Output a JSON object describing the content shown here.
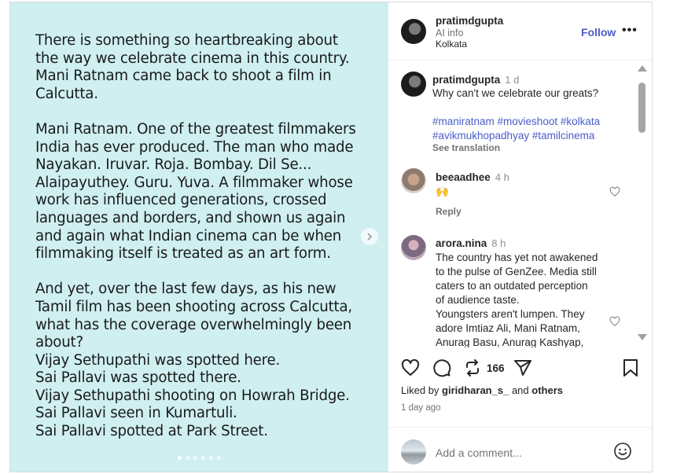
{
  "post": {
    "paragraphs": [
      [
        "There is something so heartbreaking about",
        "the way we celebrate cinema in this country.",
        "Mani Ratnam came back to shoot a film in",
        "Calcutta."
      ],
      [
        "Mani Ratnam. One of the greatest filmmakers",
        "India has ever produced. The man who made",
        "Nayakan. Iruvar. Roja. Bombay. Dil Se...",
        "Alaipayuthey. Guru. Yuva. A filmmaker whose",
        "work has influenced generations, crossed",
        "languages and borders, and shown us again",
        "and again what Indian cinema can be when",
        "filmmaking itself is treated as an art form."
      ],
      [
        "And yet, over the last few days, as his new",
        "Tamil film has been shooting across Calcutta,",
        "what has the coverage overwhelmingly been",
        "about?",
        "Vijay Sethupathi was spotted here.",
        "Sai Pallavi was spotted there.",
        "Vijay Sethupathi shooting on Howrah Bridge.",
        "Sai Pallavi seen in Kumartuli.",
        "Sai Pallavi spotted at Park Street."
      ]
    ],
    "next_icon": "chevron-right-icon"
  },
  "header": {
    "username": "pratimdgupta",
    "subtitle": "AI info",
    "location": "Kolkata",
    "follow_label": "Follow",
    "more_icon": "•••"
  },
  "caption": {
    "username": "pratimdgupta",
    "time": "1 d",
    "text": "Why can't we celebrate our greats?",
    "hashtags_line1": "#maniratnam #movieshoot #kolkata",
    "hashtags_line2": "#avikmukhopadhyay #tamilcinema",
    "see_translation": "See translation"
  },
  "comments": [
    {
      "username": "beeaadhee",
      "time": "4 h",
      "text": "🙌",
      "reply_label": "Reply"
    },
    {
      "username": "arora.nina",
      "time": "8 h",
      "lines": [
        "The country has yet not awakened",
        "to the pulse of GenZee. Media still",
        "caters to an outdated perception",
        "of audience taste.",
        "Youngsters aren't lumpen. They",
        "adore Imtiaz Ali, Mani Ratnam,",
        "Anurag Basu, Anurag Kashyap,"
      ]
    }
  ],
  "actions": {
    "share_count": "166",
    "liked_by_prefix": "Liked by",
    "liked_by_user": "giridharan_s_",
    "liked_by_and": "and",
    "liked_by_others": "others",
    "date": "1 day ago",
    "add_comment_placeholder": "Add a comment..."
  },
  "colors": {
    "media_bg": "#cfeff1",
    "link_blue": "#4a5dc8"
  }
}
